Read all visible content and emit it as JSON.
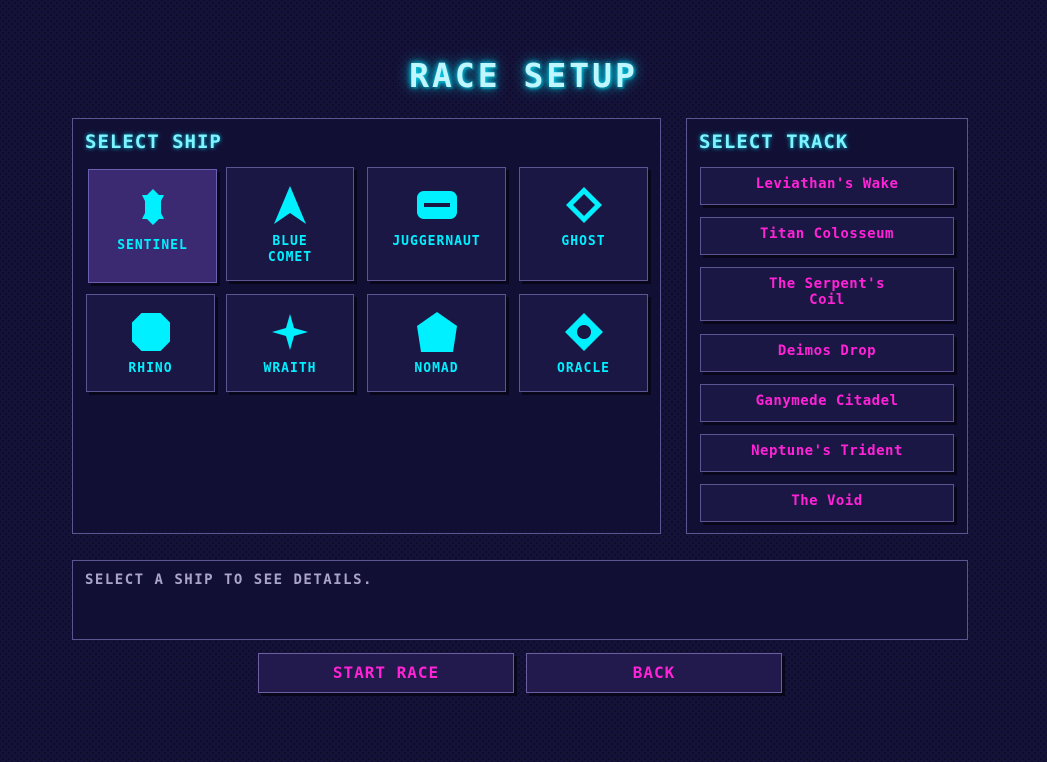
{
  "title": "RACE SETUP",
  "ship_panel": {
    "heading": "SELECT SHIP",
    "ships": [
      {
        "name": "SENTINEL",
        "icon": "sentinel-icon",
        "selected": true
      },
      {
        "name": "BLUE\nCOMET",
        "icon": "comet-arrow-icon",
        "selected": false
      },
      {
        "name": "JUGGERNAUT",
        "icon": "juggernaut-icon",
        "selected": false
      },
      {
        "name": "GHOST",
        "icon": "diamond-outline-icon",
        "selected": false
      },
      {
        "name": "RHINO",
        "icon": "octagon-icon",
        "selected": false
      },
      {
        "name": "WRAITH",
        "icon": "four-point-star-icon",
        "selected": false
      },
      {
        "name": "NOMAD",
        "icon": "pentagon-icon",
        "selected": false
      },
      {
        "name": "ORACLE",
        "icon": "diamond-eye-icon",
        "selected": false
      }
    ]
  },
  "track_panel": {
    "heading": "SELECT TRACK",
    "tracks": [
      "Leviathan's Wake",
      "Titan Colosseum",
      "The Serpent's\nCoil",
      "Deimos Drop",
      "Ganymede Citadel",
      "Neptune's Trident",
      "The Void"
    ]
  },
  "details": {
    "text": "SELECT A SHIP TO SEE DETAILS."
  },
  "buttons": {
    "start": "START RACE",
    "back": "BACK"
  },
  "colors": {
    "background": "#15123a",
    "panel": "#120f35",
    "accent_cyan": "#00f0ff",
    "accent_magenta": "#ff22d6",
    "selected_card": "#3b2a72"
  }
}
